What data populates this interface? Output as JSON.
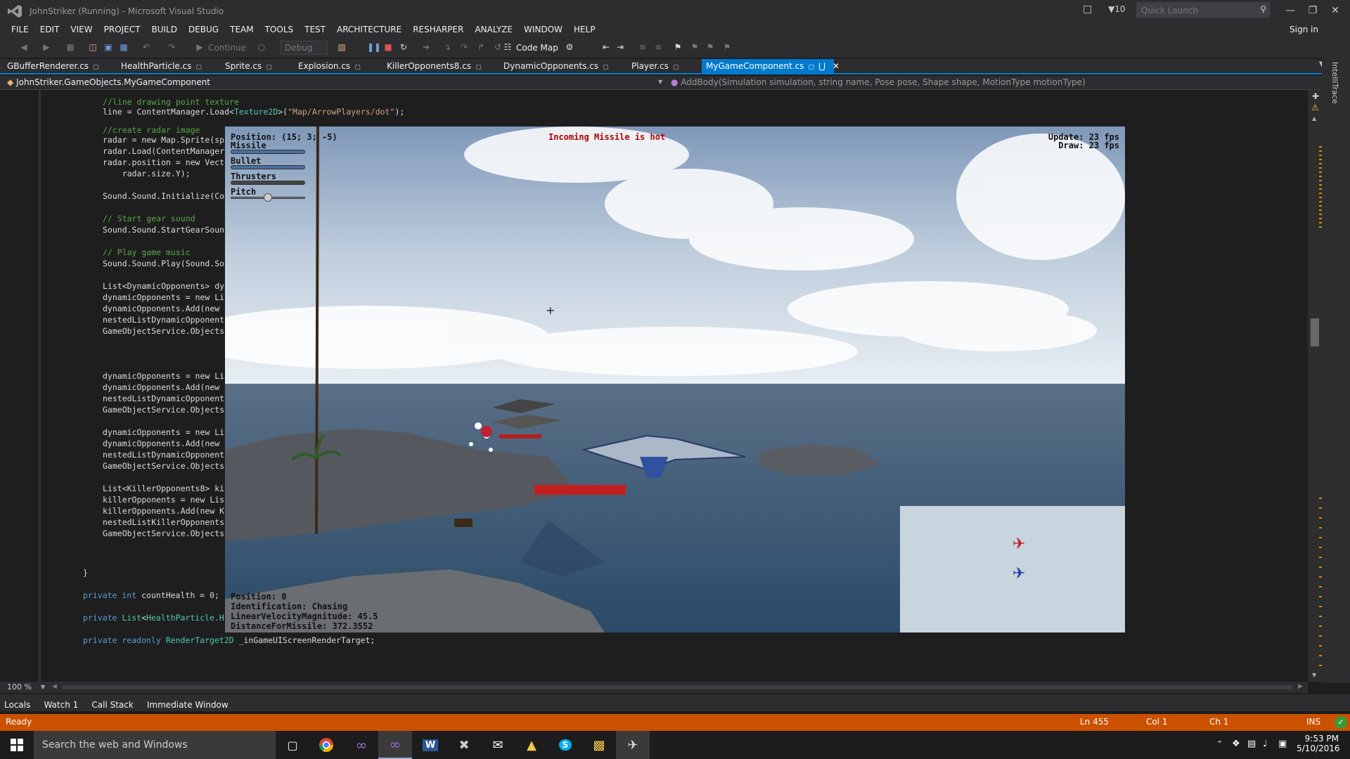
{
  "window": {
    "title": "JohnStriker (Running) - Microsoft Visual Studio",
    "notifications_count": "10",
    "quick_launch_placeholder": "Quick Launch"
  },
  "menu": {
    "items": [
      "FILE",
      "EDIT",
      "VIEW",
      "PROJECT",
      "BUILD",
      "DEBUG",
      "TEAM",
      "TOOLS",
      "TEST",
      "ARCHITECTURE",
      "RESHARPER",
      "ANALYZE",
      "WINDOW",
      "HELP"
    ],
    "sign_in": "Sign in"
  },
  "toolbar": {
    "continue_label": "Continue",
    "config": "Debug",
    "code_map_label": "Code Map"
  },
  "tabs": [
    {
      "label": "GBufferRenderer.cs"
    },
    {
      "label": "HealthParticle.cs"
    },
    {
      "label": "Sprite.cs"
    },
    {
      "label": "Explosion.cs"
    },
    {
      "label": "KillerOpponents8.cs"
    },
    {
      "label": "DynamicOpponents.cs"
    },
    {
      "label": "Player.cs"
    },
    {
      "label": "MyGameComponent.cs"
    }
  ],
  "navbar": {
    "class_path": "JohnStriker.GameObjects.MyGameComponent",
    "member": "AddBody(Simulation simulation, string name, Pose pose, Shape shape, MotionType motionType)"
  },
  "code_lines": [
    "//line drawing point texture",
    "line = ContentManager.Load<Texture2D>(\"Map/ArrowPlayers/dot\");",
    "//create radar image",
    "radar = new Map.Sprite(sp",
    "radar.Load(ContentManager",
    "radar.position = new Vect",
    "    radar.size.Y);",
    "Sound.Sound.Initialize(Co",
    "// Start gear sound",
    "Sound.Sound.StartGearSoun",
    "// Play game music",
    "Sound.Sound.Play(Sound.So",
    "List<DynamicOpponents> dy",
    "dynamicOpponents = new Li",
    "dynamicOpponents.Add(new",
    "nestedListDynamicOpponent",
    "GameObjectService.Objects",
    "dynamicOpponents = new Li",
    "dynamicOpponents.Add(new",
    "nestedListDynamicOpponent",
    "GameObjectService.Objects",
    "dynamicOpponents = new Li",
    "dynamicOpponents.Add(new",
    "nestedListDynamicOpponent",
    "GameObjectService.Objects",
    "List<KillerOpponents8> ki",
    "killerOpponents = new Lis",
    "killerOpponents.Add(new K",
    "nestedListKillerOpponents",
    "GameObjectService.Objects",
    "}",
    "private int countHealth = 0;",
    "private List<HealthParticle.H",
    "private readonly RenderTarget2D _inGameUIScreenRenderTarget;"
  ],
  "game": {
    "position_label": "Position: (15; 3; -5)",
    "missile_label": "Missile",
    "bullet_label": "Bullet",
    "thrusters_label": "Thrusters",
    "pitch_label": "Pitch",
    "missile_level": 1.0,
    "bullet_level": 1.0,
    "thrusters_level": 0.0,
    "pitch_level": 0.5,
    "alert": "Incoming Missile is hot",
    "update_fps": "Update: 23 fps",
    "draw_fps": "Draw: 23 fps",
    "info_position": "Position: 0",
    "info_identification": "Identification: Chasing",
    "info_velocity": "LinearVelocityMagnitude: 45.5",
    "info_distance": "DistanceForMissile: 372.3552"
  },
  "editor": {
    "zoom": "100 %"
  },
  "debug_tabs": [
    "Locals",
    "Watch 1",
    "Call Stack",
    "Immediate Window"
  ],
  "status": {
    "state": "Ready",
    "line": "Ln 455",
    "col": "Col 1",
    "ch": "Ch 1",
    "mode": "INS"
  },
  "taskbar": {
    "search_placeholder": "Search the web and Windows",
    "time": "9:53 PM",
    "date": "5/10/2016"
  },
  "colors": {
    "accent": "#007acc",
    "status_bar": "#ca5100",
    "alert_text": "#b00000"
  }
}
